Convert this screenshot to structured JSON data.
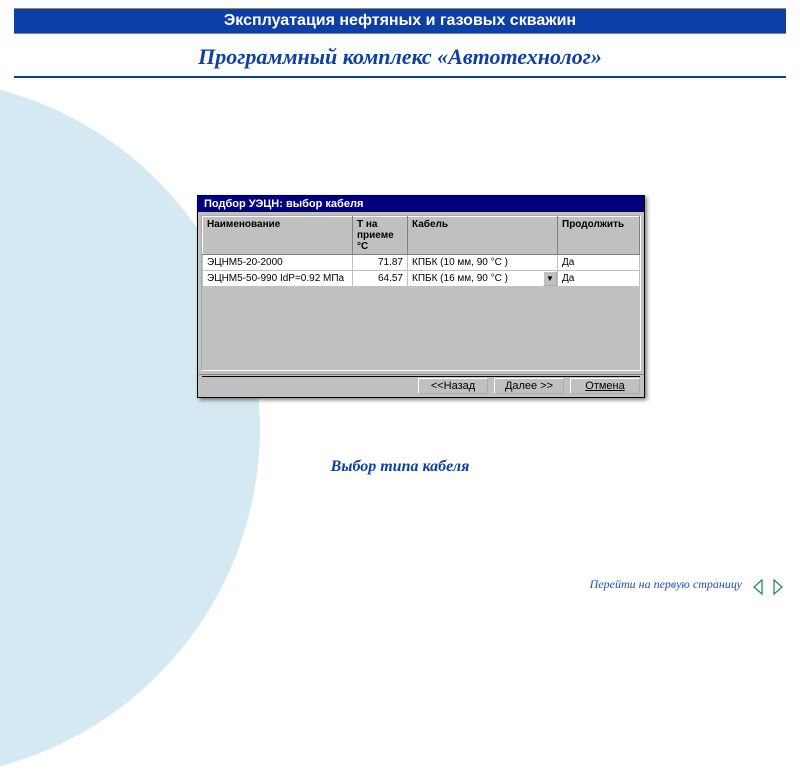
{
  "header": {
    "title": "Эксплуатация нефтяных и газовых скважин"
  },
  "page": {
    "title": "Программный комплекс «Автотехнолог»"
  },
  "dialog": {
    "title": "Подбор УЭЦН: выбор кабеля",
    "columns": {
      "name": "Наименование",
      "temp": "Т на приеме °С",
      "cable": "Кабель",
      "cont": "Продолжить"
    },
    "rows": [
      {
        "name": "ЭЦНМ5-20-2000",
        "temp": "71.87",
        "cable": "КПБК (10 мм, 90 °С )",
        "cont": "Да"
      },
      {
        "name": "ЭЦНМ5-50-990 IdP=0.92 МПа",
        "temp": "64.57",
        "cable": "КПБК (16 мм, 90 °С )",
        "cont": "Да"
      }
    ],
    "buttons": {
      "back": "<<Назад",
      "next": "Далее >>",
      "cancel": "Отмена"
    }
  },
  "caption": "Выбор типа кабеля",
  "footer": {
    "link": "Перейти на первую страницу"
  }
}
